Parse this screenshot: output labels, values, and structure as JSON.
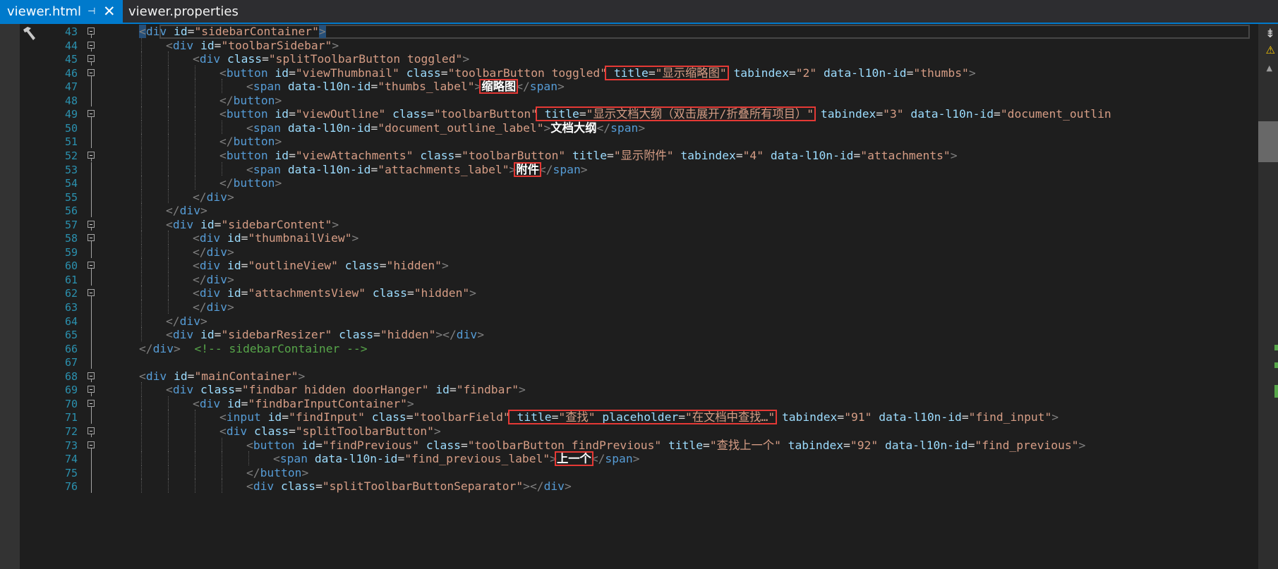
{
  "tabs": [
    {
      "label": "viewer.html",
      "pin": "⊣",
      "close": "✕"
    },
    {
      "label": "viewer.properties"
    }
  ],
  "colors": {
    "accent": "#007acc",
    "line_number": "#2b91af",
    "tag_bracket": "#808080",
    "element": "#569cd6",
    "attribute": "#9cdcfe",
    "string": "#d69d85",
    "comment": "#57a64a",
    "highlight_box": "#e53935"
  },
  "icons": {
    "gutter": "hammer-icon",
    "split": "split-editor-icon",
    "warning": "warning-icon",
    "scroll_up": "scroll-up-icon"
  },
  "lines": [
    {
      "num": "43",
      "fold": true,
      "indent": 0
    },
    {
      "num": "44",
      "fold": true,
      "indent": 1
    },
    {
      "num": "45",
      "fold": true,
      "indent": 2
    },
    {
      "num": "46",
      "fold": true,
      "indent": 3
    },
    {
      "num": "47",
      "fold": false,
      "indent": 4
    },
    {
      "num": "48",
      "fold": false,
      "indent": 3
    },
    {
      "num": "49",
      "fold": true,
      "indent": 3
    },
    {
      "num": "50",
      "fold": false,
      "indent": 4
    },
    {
      "num": "51",
      "fold": false,
      "indent": 3
    },
    {
      "num": "52",
      "fold": true,
      "indent": 3
    },
    {
      "num": "53",
      "fold": false,
      "indent": 4
    },
    {
      "num": "54",
      "fold": false,
      "indent": 3
    },
    {
      "num": "55",
      "fold": false,
      "indent": 2
    },
    {
      "num": "56",
      "fold": false,
      "indent": 1
    },
    {
      "num": "57",
      "fold": true,
      "indent": 1
    },
    {
      "num": "58",
      "fold": true,
      "indent": 2
    },
    {
      "num": "59",
      "fold": false,
      "indent": 2
    },
    {
      "num": "60",
      "fold": true,
      "indent": 2
    },
    {
      "num": "61",
      "fold": false,
      "indent": 2
    },
    {
      "num": "62",
      "fold": true,
      "indent": 2
    },
    {
      "num": "63",
      "fold": false,
      "indent": 2
    },
    {
      "num": "64",
      "fold": false,
      "indent": 1
    },
    {
      "num": "65",
      "fold": false,
      "indent": 1
    },
    {
      "num": "66",
      "fold": false,
      "indent": 0
    },
    {
      "num": "67",
      "fold": false,
      "indent": 0
    },
    {
      "num": "68",
      "fold": true,
      "indent": 0
    },
    {
      "num": "69",
      "fold": true,
      "indent": 1
    },
    {
      "num": "70",
      "fold": true,
      "indent": 2
    },
    {
      "num": "71",
      "fold": false,
      "indent": 3
    },
    {
      "num": "72",
      "fold": true,
      "indent": 3
    },
    {
      "num": "73",
      "fold": true,
      "indent": 4
    },
    {
      "num": "74",
      "fold": false,
      "indent": 5
    },
    {
      "num": "75",
      "fold": false,
      "indent": 4
    },
    {
      "num": "76",
      "fold": false,
      "indent": 4
    }
  ],
  "code": {
    "l43": [
      "<",
      "div",
      " id",
      "=",
      "\"sidebarContainer\"",
      ">"
    ],
    "l44": [
      "<",
      "div",
      " id",
      "=",
      "\"toolbarSidebar\"",
      ">"
    ],
    "l45": [
      "<",
      "div",
      " class",
      "=",
      "\"splitToolbarButton toggled\"",
      ">"
    ],
    "l46": [
      "<",
      "button",
      " id",
      "=",
      "\"viewThumbnail\"",
      " class",
      "=",
      "\"toolbarButton toggled\"",
      " title",
      "=",
      "\"显示缩略图\"",
      " tabindex",
      "=",
      "\"2\"",
      " data-l10n-id",
      "=",
      "\"thumbs\"",
      ">"
    ],
    "l47": [
      "<",
      "span",
      " data-l10n-id",
      "=",
      "\"thumbs_label\"",
      ">",
      "缩略图",
      "</",
      "span",
      ">"
    ],
    "l48": [
      "</",
      "button",
      ">"
    ],
    "l49": [
      "<",
      "button",
      " id",
      "=",
      "\"viewOutline\"",
      " class",
      "=",
      "\"toolbarButton\"",
      " title",
      "=",
      "\"显示文档大纲（双击展开/折叠所有项目）\"",
      " tabindex",
      "=",
      "\"3\"",
      " data-l10n-id",
      "=",
      "\"document_outlin"
    ],
    "l50": [
      "<",
      "span",
      " data-l10n-id",
      "=",
      "\"document_outline_label\"",
      ">",
      "文档大纲",
      "</",
      "span",
      ">"
    ],
    "l51": [
      "</",
      "button",
      ">"
    ],
    "l52": [
      "<",
      "button",
      " id",
      "=",
      "\"viewAttachments\"",
      " class",
      "=",
      "\"toolbarButton\"",
      " title",
      "=",
      "\"显示附件\"",
      " tabindex",
      "=",
      "\"4\"",
      " data-l10n-id",
      "=",
      "\"attachments\"",
      ">"
    ],
    "l53": [
      "<",
      "span",
      " data-l10n-id",
      "=",
      "\"attachments_label\"",
      ">",
      "附件",
      "</",
      "span",
      ">"
    ],
    "l54": [
      "</",
      "button",
      ">"
    ],
    "l55": [
      "</",
      "div",
      ">"
    ],
    "l56": [
      "</",
      "div",
      ">"
    ],
    "l57": [
      "<",
      "div",
      " id",
      "=",
      "\"sidebarContent\"",
      ">"
    ],
    "l58": [
      "<",
      "div",
      " id",
      "=",
      "\"thumbnailView\"",
      ">"
    ],
    "l59": [
      "</",
      "div",
      ">"
    ],
    "l60": [
      "<",
      "div",
      " id",
      "=",
      "\"outlineView\"",
      " class",
      "=",
      "\"hidden\"",
      ">"
    ],
    "l61": [
      "</",
      "div",
      ">"
    ],
    "l62": [
      "<",
      "div",
      " id",
      "=",
      "\"attachmentsView\"",
      " class",
      "=",
      "\"hidden\"",
      ">"
    ],
    "l63": [
      "</",
      "div",
      ">"
    ],
    "l64": [
      "</",
      "div",
      ">"
    ],
    "l65": [
      "<",
      "div",
      " id",
      "=",
      "\"sidebarResizer\"",
      " class",
      "=",
      "\"hidden\"",
      "></",
      "div",
      ">"
    ],
    "l66": [
      "</",
      "div",
      ">",
      "  <!-- sidebarContainer -->"
    ],
    "l67": [],
    "l68": [
      "<",
      "div",
      " id",
      "=",
      "\"mainContainer\"",
      ">"
    ],
    "l69": [
      "<",
      "div",
      " class",
      "=",
      "\"findbar hidden doorHanger\"",
      " id",
      "=",
      "\"findbar\"",
      ">"
    ],
    "l70": [
      "<",
      "div",
      " id",
      "=",
      "\"findbarInputContainer\"",
      ">"
    ],
    "l71": [
      "<",
      "input",
      " id",
      "=",
      "\"findInput\"",
      " class",
      "=",
      "\"toolbarField\"",
      " title",
      "=",
      "\"查找\"",
      " placeholder",
      "=",
      "\"在文档中查找…\"",
      " tabindex",
      "=",
      "\"91\"",
      " data-l10n-id",
      "=",
      "\"find_input\"",
      ">"
    ],
    "l72": [
      "<",
      "div",
      " class",
      "=",
      "\"splitToolbarButton\"",
      ">"
    ],
    "l73": [
      "<",
      "button",
      " id",
      "=",
      "\"findPrevious\"",
      " class",
      "=",
      "\"toolbarButton findPrevious\"",
      " title",
      "=",
      "\"查找上一个\"",
      " tabindex",
      "=",
      "\"92\"",
      " data-l10n-id",
      "=",
      "\"find_previous\"",
      ">"
    ],
    "l74": [
      "<",
      "span",
      " data-l10n-id",
      "=",
      "\"find_previous_label\"",
      ">",
      "上一个",
      "</",
      "span",
      ">"
    ],
    "l75": [
      "</",
      "button",
      ">"
    ],
    "l76": [
      "<",
      "div",
      " class",
      "=",
      "\"splitToolbarButtonSeparator\"",
      "></",
      "div",
      ">"
    ]
  }
}
